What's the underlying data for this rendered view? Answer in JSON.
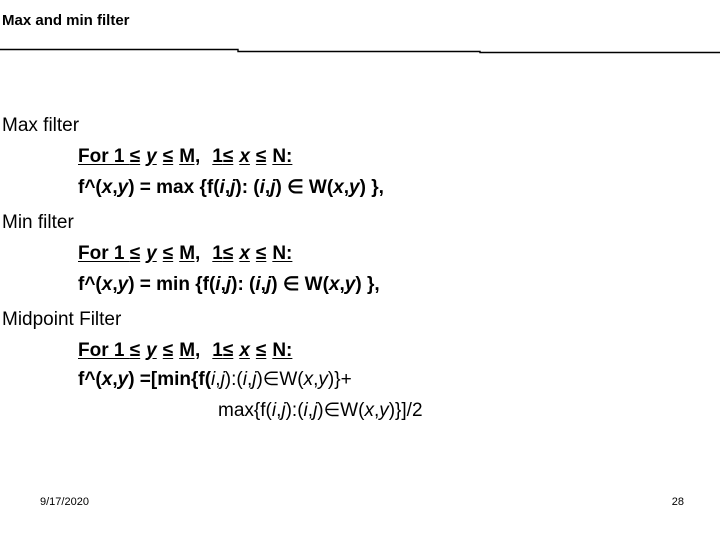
{
  "slide": {
    "title": "Max and min filter",
    "divider_color": "#000000",
    "text_color": "#000000",
    "background_color": "#ffffff"
  },
  "body": {
    "sections": [
      {
        "heading": "Max filter",
        "for_line": {
          "prefix": "For 1 ",
          "le1": "≤",
          "var1": "y",
          "le2": "≤",
          "bound1": "M,",
          "mid": "1",
          "le3": "≤",
          "var2": "x",
          "le4": "≤",
          "bound2": "N:",
          "full_text": "For 1 ≤ y ≤ M,  1≤ x ≤ N:"
        },
        "equation": {
          "lhs": "f^(",
          "lhs_x": "x",
          "lhs_sep": ", ",
          "lhs_y": "y",
          "op": ") = max {f(",
          "i1": "i",
          "c1": ", ",
          "j1": "j",
          "mid": "):  (",
          "i2": "i",
          "c2": ", ",
          "j2": "j",
          "elem": ") ∈ W(",
          "rx": "x",
          "rc": ", ",
          "ry": "y",
          "tail": ") },",
          "full_text": "f^(x, y) = max {f(i, j):  (i, j) ∈ W(x, y) },"
        }
      },
      {
        "heading": "Min filter",
        "for_line": {
          "prefix": "For 1 ",
          "le1": "≤",
          "var1": "y",
          "le2": "≤",
          "bound1": "M,",
          "mid": "1",
          "le3": "≤",
          "var2": "x",
          "le4": "≤",
          "bound2": "N:",
          "full_text": "For 1 ≤ y ≤ M,  1≤ x ≤ N:"
        },
        "equation": {
          "lhs": "f^(",
          "lhs_x": "x",
          "lhs_sep": ", ",
          "lhs_y": "y",
          "op": ") = min {f(",
          "i1": "i",
          "c1": ", ",
          "j1": "j",
          "mid": "):  (",
          "i2": "i",
          "c2": ", ",
          "j2": "j",
          "elem": ") ∈ W(",
          "rx": "x",
          "rc": ", ",
          "ry": "y",
          "tail": ") },",
          "full_text": "f^(x, y) = min {f(i, j):  (i, j) ∈ W(x, y) },"
        }
      },
      {
        "heading": "Midpoint Filter",
        "for_line": {
          "prefix": "For 1 ",
          "le1": "≤",
          "var1": "y",
          "le2": "≤",
          "bound1": "M,",
          "mid": "1",
          "le3": "≤",
          "var2": "x",
          "le4": "≤",
          "bound2": "N:",
          "full_text": "For 1 ≤ y ≤ M,  1≤ x ≤ N:"
        },
        "equation_a": {
          "lhs": "f^(",
          "lhs_x": "x",
          "lhs_sep": ", ",
          "lhs_y": "y",
          "op": ") =[min{f(",
          "i1": "i",
          "c1": ", ",
          "j1": "j",
          "mid": "):(",
          "i2": "i",
          "c2": ", ",
          "j2": "j",
          "elem": ")∈W(",
          "rx": "x",
          "rc": ", ",
          "ry": "y",
          "tail": ")}+",
          "full_text": "f^(x, y) =[min{f(i, j):(i, j)∈W(x, y)}+"
        },
        "equation_b": {
          "op": "max{f(",
          "i1": "i",
          "c1": ", ",
          "j1": "j",
          "mid": "):(",
          "i2": "i",
          "c2": ", ",
          "j2": "j",
          "elem": ")∈W(",
          "rx": "x",
          "rc": ", ",
          "ry": "y",
          "tail": ")}]/2",
          "full_text": "max{f(i, j):(i, j)∈W(x, y)}]/2"
        }
      }
    ]
  },
  "footer": {
    "date": "9/17/2020",
    "page_number": "28"
  }
}
